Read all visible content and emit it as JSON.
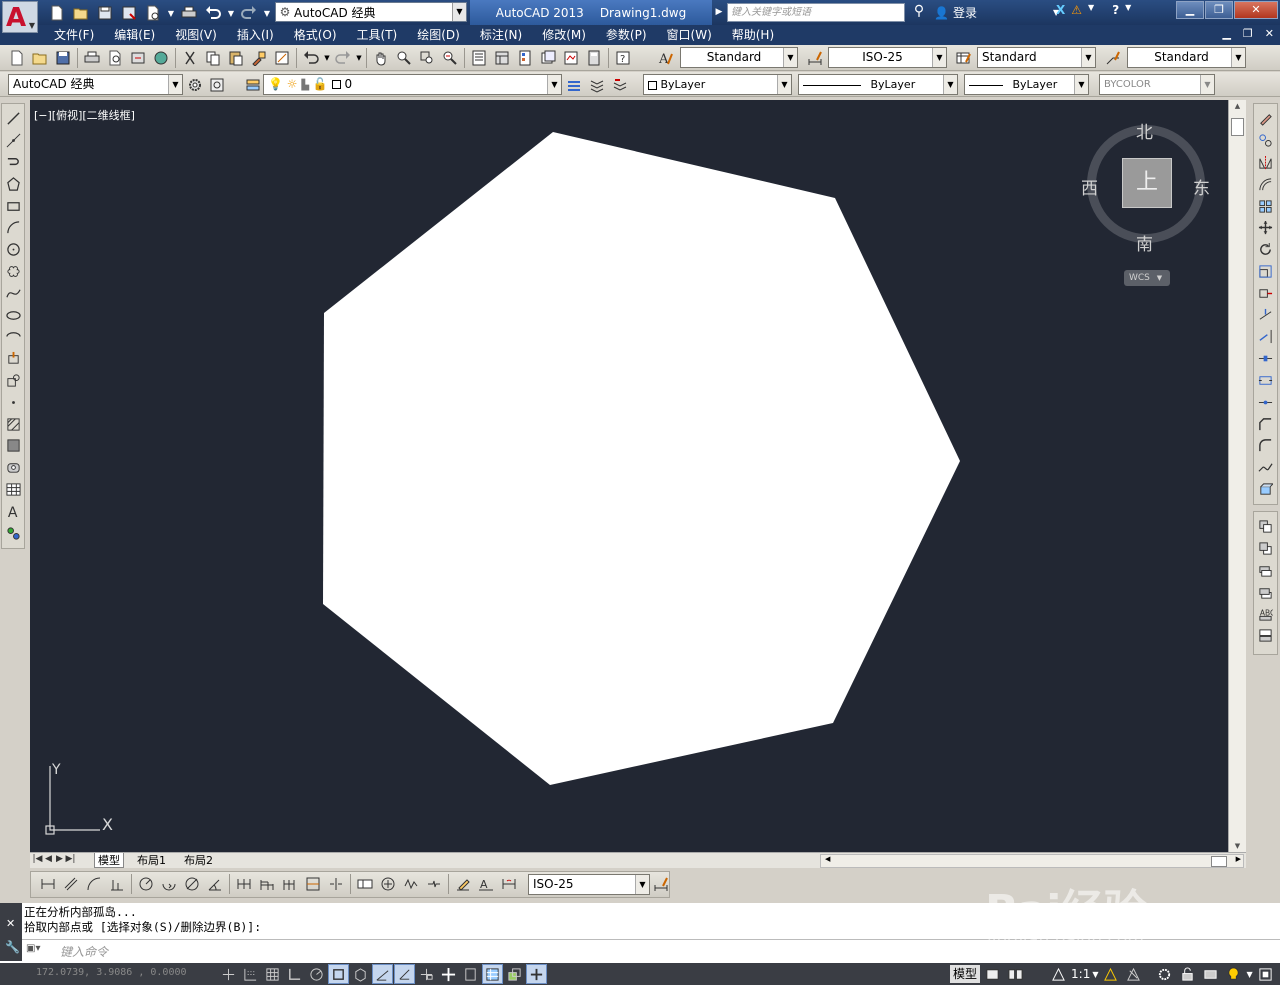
{
  "title_bar": {
    "workspace": "AutoCAD 经典",
    "app_name": "AutoCAD 2013",
    "document": "Drawing1.dwg",
    "search_placeholder": "键入关键字或短语",
    "login_label": "登录"
  },
  "menu": {
    "items": [
      "文件(F)",
      "编辑(E)",
      "视图(V)",
      "插入(I)",
      "格式(O)",
      "工具(T)",
      "绘图(D)",
      "标注(N)",
      "修改(M)",
      "参数(P)",
      "窗口(W)",
      "帮助(H)"
    ]
  },
  "styles_toolbar": {
    "text_style": "Standard",
    "dim_style": "ISO-25",
    "table_style": "Standard",
    "multileader_style": "Standard"
  },
  "workspace_toolbar": {
    "workspace": "AutoCAD 经典"
  },
  "layers_toolbar": {
    "current_layer": "0"
  },
  "properties_toolbar": {
    "color": "ByLayer",
    "linetype": "ByLayer",
    "lineweight": "ByLayer",
    "plot_style": "BYCOLOR"
  },
  "viewport": {
    "label": "[−][俯视][二维线框]",
    "background": "#222733",
    "shape_fill": "#ffffff"
  },
  "viewcube": {
    "north": "北",
    "south": "南",
    "west": "西",
    "east": "东",
    "top_face": "上",
    "ucs_button": "WCS"
  },
  "ucs_icon": {
    "y_label": "Y",
    "x_label": "X"
  },
  "layout_tabs": {
    "model": "模型",
    "layout1": "布局1",
    "layout2": "布局2"
  },
  "dim_toolbar": {
    "dim_style": "ISO-25"
  },
  "command_line": {
    "history": [
      "正在分析内部孤岛...",
      "拾取内部点或 [选择对象(S)/删除边界(B)]:"
    ],
    "input_placeholder": "键入命令"
  },
  "status_bar": {
    "coordinates": "172.0739,  3.9086 ,  0.0000",
    "model_label": "模型",
    "annotation_scale": "1:1"
  },
  "watermark": {
    "brand": "Bai经验",
    "url": "jingyan.baidu.com"
  }
}
